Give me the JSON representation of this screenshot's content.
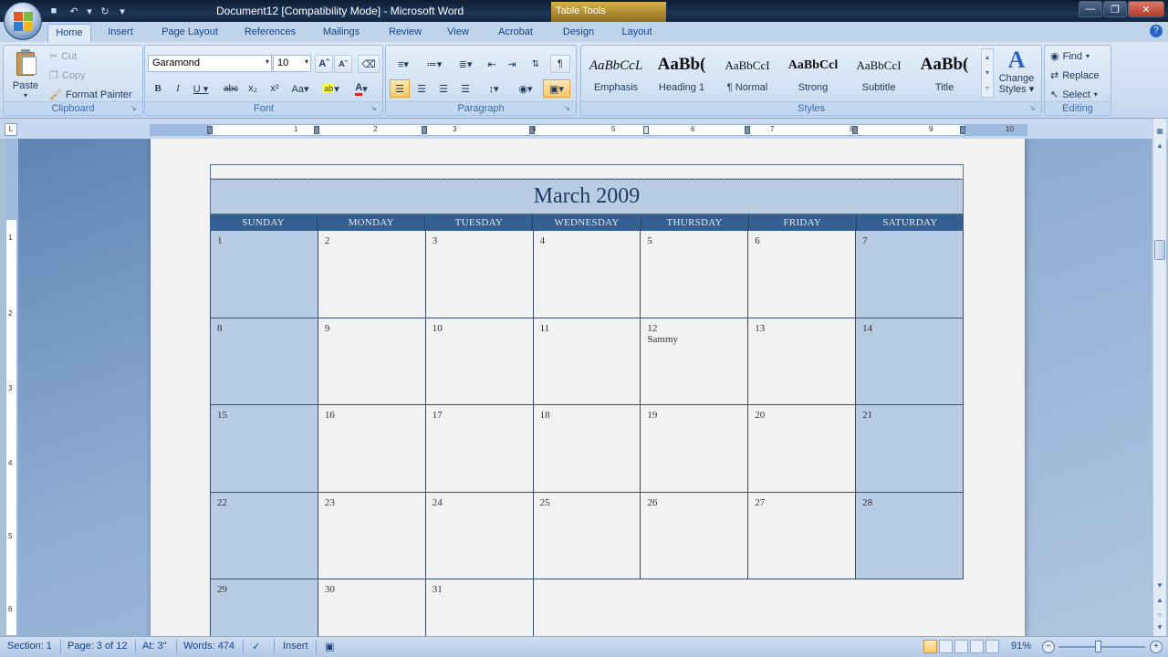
{
  "window": {
    "title": "Document12 [Compatibility Mode] - Microsoft Word",
    "contextual_tab_group": "Table Tools"
  },
  "tabs": [
    "Home",
    "Insert",
    "Page Layout",
    "References",
    "Mailings",
    "Review",
    "View",
    "Acrobat",
    "Design",
    "Layout"
  ],
  "active_tab": "Home",
  "ribbon": {
    "clipboard": {
      "label": "Clipboard",
      "paste": "Paste",
      "cut": "Cut",
      "copy": "Copy",
      "format_painter": "Format Painter"
    },
    "font": {
      "label": "Font",
      "font_name": "Garamond",
      "font_size": "10"
    },
    "paragraph": {
      "label": "Paragraph"
    },
    "styles": {
      "label": "Styles",
      "items": [
        {
          "sample": "AaBbCcL",
          "name": "Emphasis"
        },
        {
          "sample": "AaBb(",
          "name": "Heading 1"
        },
        {
          "sample": "AaBbCcI",
          "name": "¶ Normal"
        },
        {
          "sample": "AaBbCcl",
          "name": "Strong"
        },
        {
          "sample": "AaBbCcI",
          "name": "Subtitle"
        },
        {
          "sample": "AaBb(",
          "name": "Title"
        }
      ],
      "change_styles_line1": "Change",
      "change_styles_line2": "Styles"
    },
    "editing": {
      "label": "Editing",
      "find": "Find",
      "replace": "Replace",
      "select": "Select"
    }
  },
  "ruler": {
    "numbers": [
      "1",
      "2",
      "3",
      "4",
      "5",
      "6",
      "7",
      "8",
      "9",
      "10"
    ],
    "vnumbers": [
      "1",
      "2",
      "3",
      "4",
      "5",
      "6"
    ]
  },
  "calendar": {
    "title": "March 2009",
    "days": [
      "SUNDAY",
      "MONDAY",
      "TUESDAY",
      "WEDNESDAY",
      "THURSDAY",
      "FRIDAY",
      "SATURDAY"
    ],
    "weeks": [
      [
        {
          "d": "1"
        },
        {
          "d": "2"
        },
        {
          "d": "3"
        },
        {
          "d": "4"
        },
        {
          "d": "5"
        },
        {
          "d": "6"
        },
        {
          "d": "7"
        }
      ],
      [
        {
          "d": "8"
        },
        {
          "d": "9"
        },
        {
          "d": "10"
        },
        {
          "d": "11"
        },
        {
          "d": "12",
          "note": "Sammy"
        },
        {
          "d": "13"
        },
        {
          "d": "14"
        }
      ],
      [
        {
          "d": "15"
        },
        {
          "d": "16"
        },
        {
          "d": "17"
        },
        {
          "d": "18"
        },
        {
          "d": "19"
        },
        {
          "d": "20"
        },
        {
          "d": "21"
        }
      ],
      [
        {
          "d": "22"
        },
        {
          "d": "23"
        },
        {
          "d": "24"
        },
        {
          "d": "25"
        },
        {
          "d": "26"
        },
        {
          "d": "27"
        },
        {
          "d": "28"
        }
      ],
      [
        {
          "d": "29"
        },
        {
          "d": "30"
        },
        {
          "d": "31"
        },
        {
          "d": ""
        },
        {
          "d": ""
        },
        {
          "d": ""
        },
        {
          "d": ""
        }
      ]
    ]
  },
  "status": {
    "section": "Section: 1",
    "page": "Page: 3 of 12",
    "at": "At: 3\"",
    "words": "Words: 474",
    "mode": "Insert",
    "zoom": "91%"
  }
}
